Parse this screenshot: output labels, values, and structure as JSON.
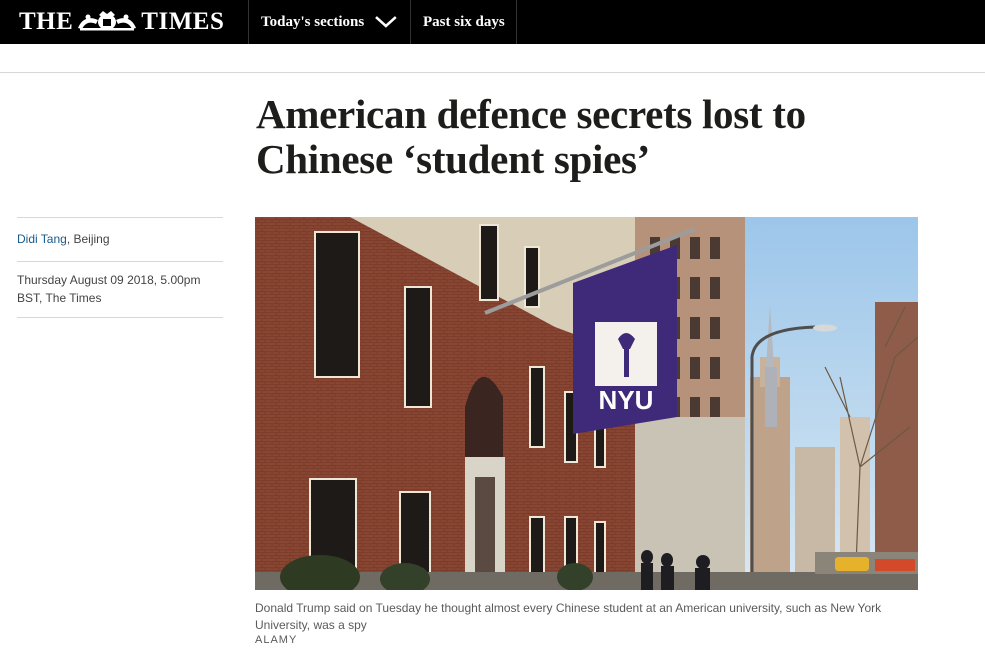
{
  "header": {
    "masthead_left": "THE",
    "masthead_right": "TIMES",
    "nav": {
      "sections_label": "Today's sections",
      "past_label": "Past six days"
    },
    "colors": {
      "background": "#000000",
      "text": "#ffffff"
    }
  },
  "article": {
    "headline_line1": "American defence secrets lost to",
    "headline_line2": "Chinese ‘student spies’",
    "byline": {
      "author": "Didi Tang",
      "location": ", Beijing"
    },
    "date": {
      "line1": "Thursday August 09 2018, 5.00pm",
      "line2": "BST, The Times"
    },
    "image": {
      "flag_text": "NYU",
      "flag_icon": "torch-icon",
      "caption_line1": "Donald Trump said on Tuesday he thought almost every Chinese student at an American university, such as New York",
      "caption_line2": "University, was a spy",
      "credit": "ALAMY"
    },
    "colors": {
      "author_link": "#1a5b8c",
      "flag": "#3f2a7a"
    }
  }
}
